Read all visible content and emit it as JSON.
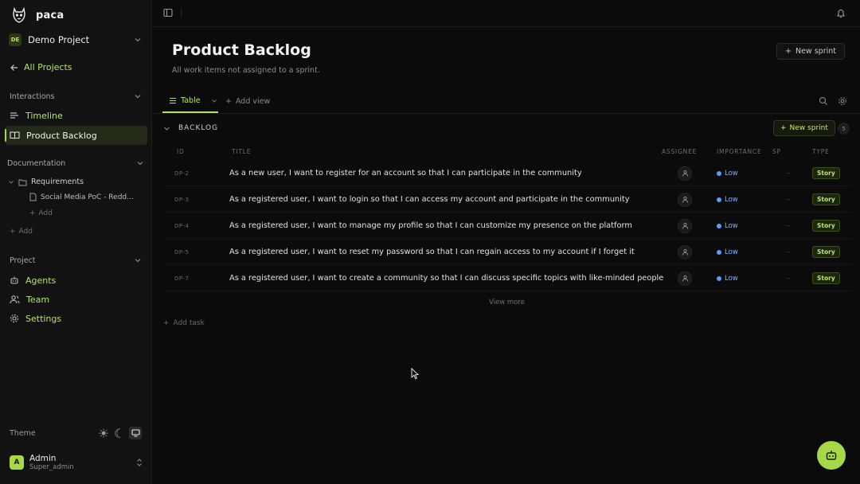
{
  "brand": {
    "name": "paca"
  },
  "project": {
    "badge": "DE",
    "name": "Demo Project"
  },
  "sidebar": {
    "all_projects": "All Projects",
    "interactions": {
      "heading": "Interactions",
      "items": [
        "Timeline",
        "Product Backlog"
      ]
    },
    "documentation": {
      "heading": "Documentation",
      "folder": "Requirements",
      "doc": "Social Media PoC - Redd...",
      "add_child": "Add",
      "add": "Add"
    },
    "project_section": {
      "heading": "Project",
      "items": [
        "Agents",
        "Team",
        "Settings"
      ]
    },
    "theme_label": "Theme",
    "user": {
      "initial": "A",
      "name": "Admin",
      "role": "Super_admin"
    }
  },
  "header": {
    "title": "Product Backlog",
    "subtitle": "All work items not assigned to a sprint.",
    "new_sprint": "New sprint"
  },
  "tabs": {
    "table": "Table",
    "add_view": "Add view"
  },
  "backlog": {
    "title": "BACKLOG",
    "new_sprint": "New sprint",
    "count": "5",
    "columns": {
      "id": "ID",
      "title": "TITLE",
      "assignee": "ASSIGNEE",
      "importance": "IMPORTANCE",
      "sp": "SP",
      "type": "TYPE"
    },
    "rows": [
      {
        "id": "DP-2",
        "title": "As a new user, I want to register for an account so that I can participate in the community",
        "importance": "Low",
        "sp": "–",
        "type": "Story"
      },
      {
        "id": "DP-3",
        "title": "As a registered user, I want to login so that I can access my account and participate in the community",
        "importance": "Low",
        "sp": "–",
        "type": "Story"
      },
      {
        "id": "DP-4",
        "title": "As a registered user, I want to manage my profile so that I can customize my presence on the platform",
        "importance": "Low",
        "sp": "–",
        "type": "Story"
      },
      {
        "id": "DP-5",
        "title": "As a registered user, I want to reset my password so that I can regain access to my account if I forget it",
        "importance": "Low",
        "sp": "–",
        "type": "Story"
      },
      {
        "id": "DP-7",
        "title": "As a registered user, I want to create a community so that I can discuss specific topics with like-minded people",
        "importance": "Low",
        "sp": "–",
        "type": "Story"
      }
    ],
    "view_more": "View more",
    "add_task": "Add task"
  },
  "colors": {
    "accent": "#a7d84a",
    "importance_low": "#5b9dff",
    "background": "#0b0b0b"
  }
}
